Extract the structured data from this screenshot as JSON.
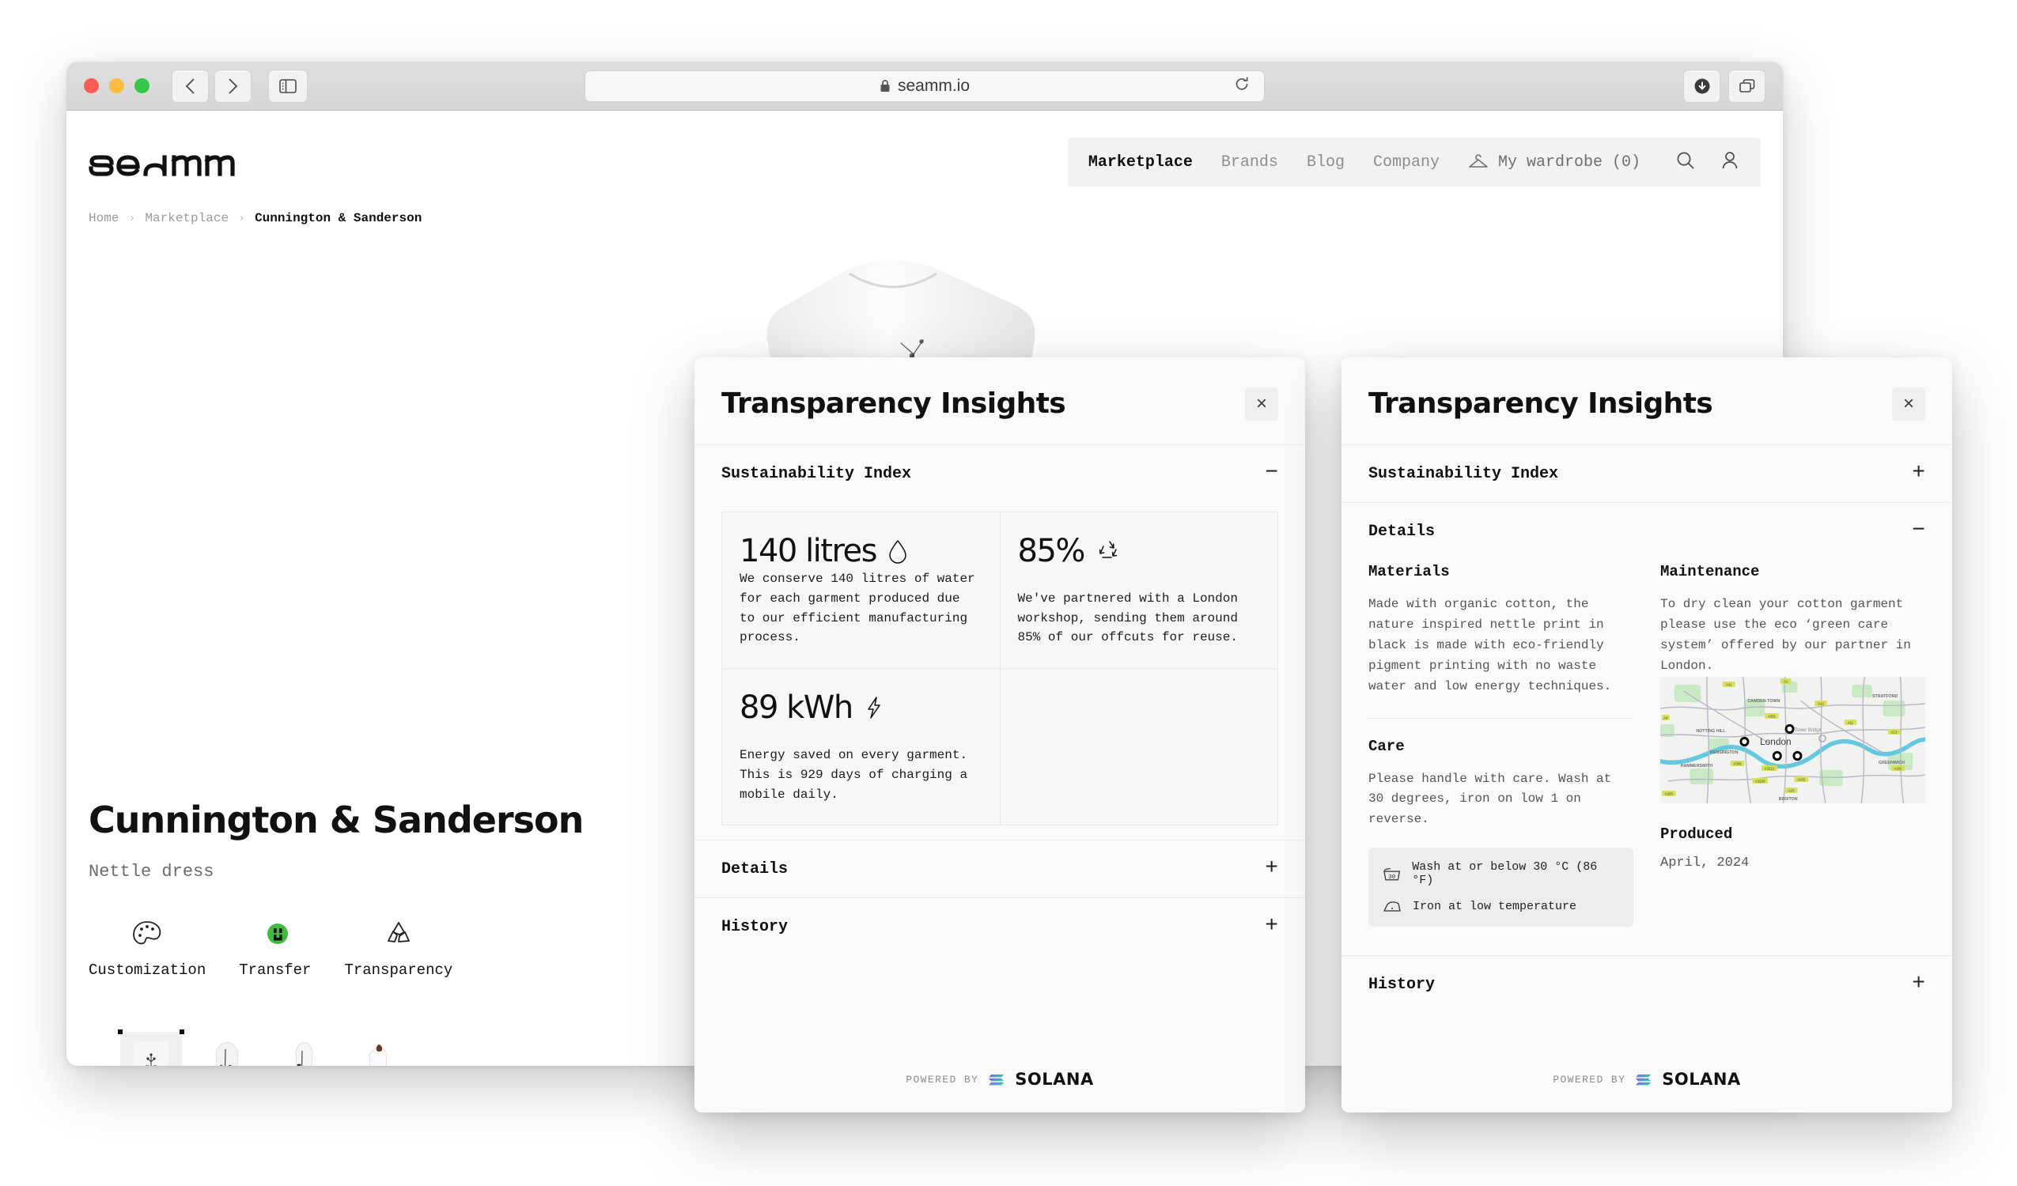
{
  "browser": {
    "url": "seamm.io",
    "lock_icon": "lock-icon",
    "back_icon": "chevron-left-icon",
    "forward_icon": "chevron-right-icon",
    "sidebar_icon": "sidebar-toggle-icon",
    "reload_icon": "reload-icon",
    "download_icon": "download-icon",
    "tabs_icon": "tab-overview-icon",
    "traffic_lights": [
      "close",
      "minimize",
      "zoom"
    ]
  },
  "site": {
    "logo_text": "seamm",
    "breadcrumb": [
      {
        "label": "Home"
      },
      {
        "label": "Marketplace"
      },
      {
        "label": "Cunnington & Sanderson"
      }
    ],
    "breadcrumb_separator": "›",
    "nav": [
      {
        "label": "Marketplace",
        "active": true
      },
      {
        "label": "Brands",
        "active": false
      },
      {
        "label": "Blog",
        "active": false
      },
      {
        "label": "Company",
        "active": false
      }
    ],
    "wardrobe": {
      "label": "My wardrobe (0)",
      "icon": "hanger-icon"
    },
    "icons": [
      {
        "name": "search-icon"
      },
      {
        "name": "user-account-icon"
      }
    ]
  },
  "product": {
    "brand": "Cunnington & Sanderson",
    "name": "Nettle dress",
    "features": [
      {
        "label": "Customization",
        "icon": "palette-icon"
      },
      {
        "label": "Transfer",
        "icon": "transfer-badge-icon"
      },
      {
        "label": "Transparency",
        "icon": "recycle-icon"
      }
    ],
    "thumbnails": [
      {
        "alt": "nettle print detail",
        "selected": true
      },
      {
        "alt": "dress front view",
        "selected": false
      },
      {
        "alt": "dress side view",
        "selected": false
      },
      {
        "alt": "dress back view",
        "selected": false
      }
    ]
  },
  "modal_1": {
    "title": "Transparency Insights",
    "close_label": "×",
    "sections": [
      {
        "label": "Sustainability Index",
        "sign": "−",
        "expanded": true
      },
      {
        "label": "Details",
        "sign": "+",
        "expanded": false
      },
      {
        "label": "History",
        "sign": "+",
        "expanded": false
      }
    ],
    "metrics": [
      {
        "value": "140 litres",
        "icon": "water-drop-icon",
        "description": "We conserve 140 litres of water for each garment produced due to our efficient manufacturing process."
      },
      {
        "value": "85%",
        "icon": "recycle-icon",
        "description": "We've partnered with a London workshop, sending them around 85% of our offcuts for reuse."
      },
      {
        "value": "89 kWh",
        "icon": "lightning-bolt-icon",
        "description": "Energy saved on every garment. This is 929 days of charging a mobile daily."
      }
    ],
    "footer": {
      "powered_by": "POWERED BY",
      "brand": "SOLANA",
      "icon": "solana-logo-icon"
    }
  },
  "modal_2": {
    "title": "Transparency Insights",
    "close_label": "×",
    "sections": [
      {
        "label": "Sustainability Index",
        "sign": "+",
        "expanded": false
      },
      {
        "label": "Details",
        "sign": "−",
        "expanded": true
      },
      {
        "label": "History",
        "sign": "+",
        "expanded": false
      }
    ],
    "details": {
      "materials_heading": "Materials",
      "materials_text": "Made with organic cotton, the nature inspired nettle print in black is made with eco-friendly pigment printing with no waste water and low energy techniques.",
      "care_heading": "Care",
      "care_text": "Please handle with care. Wash at 30 degrees, iron on low 1 on reverse.",
      "care_badges": [
        {
          "label": "Wash at or below 30 °C (86 °F)",
          "icon": "wash-tub-30-icon"
        },
        {
          "label": "Iron at low temperature",
          "icon": "iron-icon"
        }
      ],
      "maintenance_heading": "Maintenance",
      "maintenance_text": "To dry clean your cotton garment please use the eco ‘green care system’ offered by our partner in London.",
      "produced_heading": "Produced",
      "produced_value": "April, 2024"
    },
    "map": {
      "city_label": "London",
      "place_labels": [
        "CAMDEN TOWN",
        "STRATFORD",
        "NOTTING HILL",
        "KENSINGTON",
        "HAMMERSMITH",
        "GREENWICH",
        "BRIXTON",
        "Tower Bridge"
      ],
      "road_shields": [
        "A41",
        "A501",
        "A11",
        "A12",
        "A13",
        "A102",
        "A202",
        "A23",
        "A3212",
        "A3220",
        "A406",
        "A4"
      ],
      "marker_count": 4,
      "water_color": "#64c8e0",
      "park_color": "#c9e8c4"
    },
    "footer": {
      "powered_by": "POWERED BY",
      "brand": "SOLANA",
      "icon": "solana-logo-icon"
    }
  },
  "colors": {
    "accent_green": "#3fbb3f",
    "modal_bg": "#fafafa",
    "card_bg": "#f7f7f7",
    "text": "#111111",
    "muted": "#8d8d8d"
  }
}
